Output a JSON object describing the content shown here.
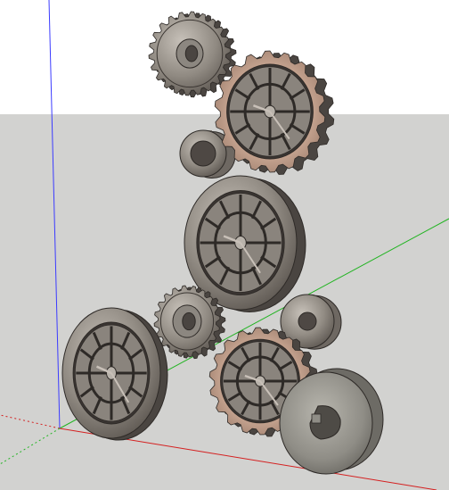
{
  "viewport": {
    "sky_color": "#ffffff",
    "ground_color": "#d2d2d0",
    "axis_colors": {
      "blue": "#3b3bff",
      "red": "#d42020",
      "green": "#22b422"
    }
  },
  "model": {
    "materials": {
      "steel": "#8c8780",
      "steel_dark": "#4a4541",
      "steel_light": "#b9b3ab",
      "rust": "#c79a80",
      "stone": "#9c9a92",
      "clock_hand": "#c8c0b8"
    },
    "icons": [
      "gear-icon",
      "clock-gear-icon",
      "washer-icon"
    ]
  }
}
